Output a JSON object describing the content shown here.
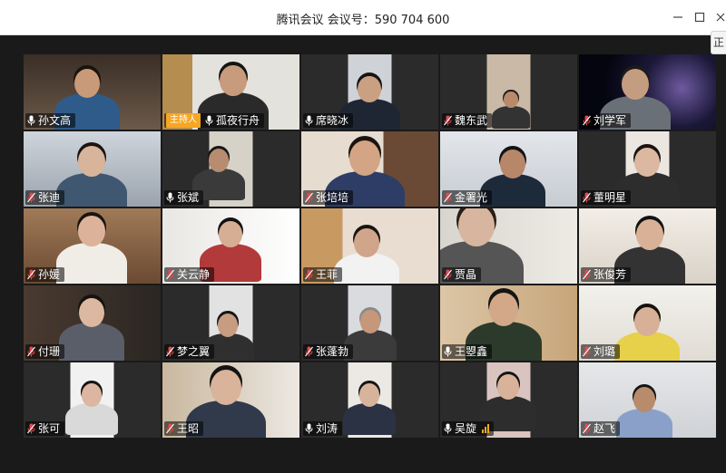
{
  "window": {
    "title": "腾讯会议 会议号：590 704 600",
    "side_tab": "正"
  },
  "host_label": "主持人",
  "colors": {
    "mic_active": "#ffffff",
    "mic_muted": "#e5484d",
    "host_badge": "#f5a623"
  },
  "participants": [
    {
      "name": "孙文高",
      "mic": "on",
      "host": false
    },
    {
      "name": "孤夜行舟",
      "mic": "on",
      "host": true
    },
    {
      "name": "席晓冰",
      "mic": "on",
      "host": false
    },
    {
      "name": "魏东武",
      "mic": "muted",
      "host": false
    },
    {
      "name": "刘学军",
      "mic": "muted",
      "host": false
    },
    {
      "name": "张迪",
      "mic": "muted",
      "host": false
    },
    {
      "name": "张斌",
      "mic": "on",
      "host": false
    },
    {
      "name": "张培培",
      "mic": "muted",
      "host": false
    },
    {
      "name": "金署光",
      "mic": "muted",
      "host": false
    },
    {
      "name": "董明星",
      "mic": "muted",
      "host": false
    },
    {
      "name": "孙媛",
      "mic": "muted",
      "host": false
    },
    {
      "name": "关云静",
      "mic": "muted",
      "host": false
    },
    {
      "name": "王菲",
      "mic": "muted",
      "host": false
    },
    {
      "name": "贾晶",
      "mic": "muted",
      "host": false
    },
    {
      "name": "张俊芳",
      "mic": "muted",
      "host": false
    },
    {
      "name": "付珊",
      "mic": "muted",
      "host": false
    },
    {
      "name": "梦之翼",
      "mic": "muted",
      "host": false
    },
    {
      "name": "张蓬勃",
      "mic": "muted",
      "host": false
    },
    {
      "name": "王曌鑫",
      "mic": "on",
      "host": false
    },
    {
      "name": "刘璐",
      "mic": "muted",
      "host": false
    },
    {
      "name": "张可",
      "mic": "muted",
      "host": false
    },
    {
      "name": "王昭",
      "mic": "muted",
      "host": false
    },
    {
      "name": "刘涛",
      "mic": "on",
      "host": false
    },
    {
      "name": "吴旋",
      "mic": "on",
      "host": false,
      "speaking": true
    },
    {
      "name": "赵飞",
      "mic": "muted",
      "host": false
    }
  ]
}
